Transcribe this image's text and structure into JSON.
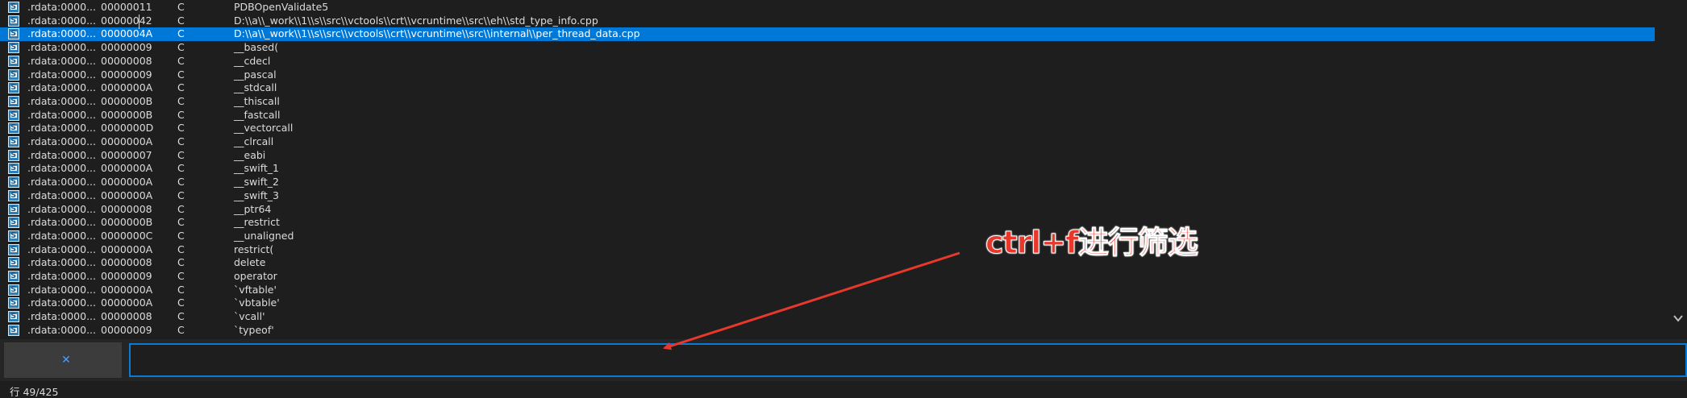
{
  "string_list": {
    "selected_index": 2,
    "rows": [
      {
        "address": ".rdata:0000...",
        "length": "00000011",
        "type": "C",
        "string": "PDBOpenValidate5"
      },
      {
        "address": ".rdata:0000...",
        "length": "00000042",
        "type": "C",
        "string": "D:\\\\a\\\\_work\\\\1\\\\s\\\\src\\\\vctools\\\\crt\\\\vcruntime\\\\src\\\\eh\\\\std_type_info.cpp"
      },
      {
        "address": ".rdata:0000...",
        "length": "0000004A",
        "type": "C",
        "string": "D:\\\\a\\\\_work\\\\1\\\\s\\\\src\\\\vctools\\\\crt\\\\vcruntime\\\\src\\\\internal\\\\per_thread_data.cpp"
      },
      {
        "address": ".rdata:0000...",
        "length": "00000009",
        "type": "C",
        "string": "__based("
      },
      {
        "address": ".rdata:0000...",
        "length": "00000008",
        "type": "C",
        "string": "__cdecl"
      },
      {
        "address": ".rdata:0000...",
        "length": "00000009",
        "type": "C",
        "string": "__pascal"
      },
      {
        "address": ".rdata:0000...",
        "length": "0000000A",
        "type": "C",
        "string": "__stdcall"
      },
      {
        "address": ".rdata:0000...",
        "length": "0000000B",
        "type": "C",
        "string": "__thiscall"
      },
      {
        "address": ".rdata:0000...",
        "length": "0000000B",
        "type": "C",
        "string": "__fastcall"
      },
      {
        "address": ".rdata:0000...",
        "length": "0000000D",
        "type": "C",
        "string": "__vectorcall"
      },
      {
        "address": ".rdata:0000...",
        "length": "0000000A",
        "type": "C",
        "string": "__clrcall"
      },
      {
        "address": ".rdata:0000...",
        "length": "00000007",
        "type": "C",
        "string": "__eabi"
      },
      {
        "address": ".rdata:0000...",
        "length": "0000000A",
        "type": "C",
        "string": "__swift_1"
      },
      {
        "address": ".rdata:0000...",
        "length": "0000000A",
        "type": "C",
        "string": "__swift_2"
      },
      {
        "address": ".rdata:0000...",
        "length": "0000000A",
        "type": "C",
        "string": "__swift_3"
      },
      {
        "address": ".rdata:0000...",
        "length": "00000008",
        "type": "C",
        "string": "__ptr64"
      },
      {
        "address": ".rdata:0000...",
        "length": "0000000B",
        "type": "C",
        "string": "__restrict"
      },
      {
        "address": ".rdata:0000...",
        "length": "0000000C",
        "type": "C",
        "string": "__unaligned"
      },
      {
        "address": ".rdata:0000...",
        "length": "0000000A",
        "type": "C",
        "string": "restrict("
      },
      {
        "address": ".rdata:0000...",
        "length": "00000008",
        "type": "C",
        "string": " delete"
      },
      {
        "address": ".rdata:0000...",
        "length": "00000009",
        "type": "C",
        "string": "operator"
      },
      {
        "address": ".rdata:0000...",
        "length": "0000000A",
        "type": "C",
        "string": "`vftable'"
      },
      {
        "address": ".rdata:0000...",
        "length": "0000000A",
        "type": "C",
        "string": "`vbtable'"
      },
      {
        "address": ".rdata:0000...",
        "length": "00000008",
        "type": "C",
        "string": "`vcall'"
      },
      {
        "address": ".rdata:0000...",
        "length": "00000009",
        "type": "C",
        "string": "`typeof'"
      }
    ]
  },
  "search": {
    "value": "",
    "close_icon": "close-icon"
  },
  "status": {
    "line_text": "行 49/425"
  },
  "annotation": {
    "text": "ctrl+f进行筛选",
    "color": "#e8382b"
  },
  "colors": {
    "selection": "#0078d7",
    "input_border": "#0a7ad4",
    "background": "#1e1e1e"
  }
}
